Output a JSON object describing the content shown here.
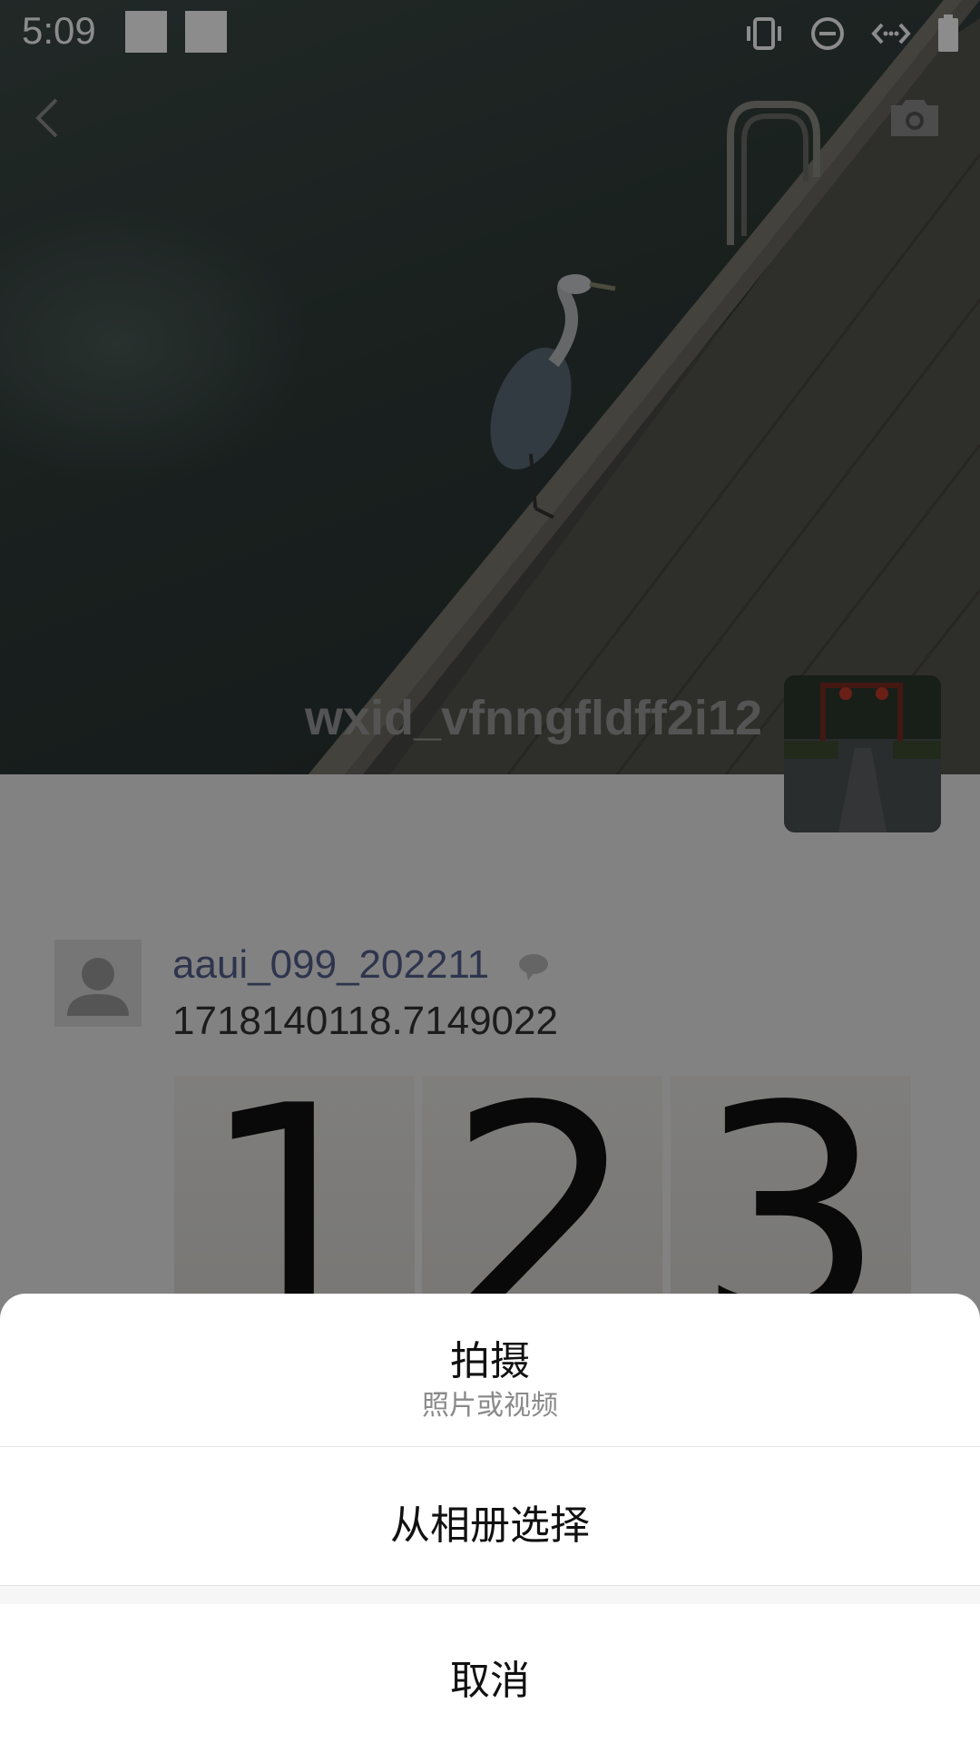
{
  "status_bar": {
    "time": "5:09",
    "icons": [
      "vibrate-icon",
      "do-not-disturb-icon",
      "data-saver-icon",
      "battery-icon"
    ]
  },
  "header": {
    "back_icon": "chevron-left-icon",
    "camera_icon": "camera-icon"
  },
  "profile": {
    "name": "wxid_vfnngfldff2i12"
  },
  "post": {
    "author": "aaui_099_202211",
    "author_icon": "cloud-icon",
    "text": "1718140118.7149022",
    "images": [
      "1",
      "2",
      "3"
    ]
  },
  "action_sheet": {
    "capture_title": "拍摄",
    "capture_subtitle": "照片或视频",
    "album": "从相册选择",
    "cancel": "取消"
  },
  "colors": {
    "author_link": "#56608f",
    "sheet_bg": "#ffffff",
    "overlay": "rgba(0,0,0,0.45)"
  }
}
